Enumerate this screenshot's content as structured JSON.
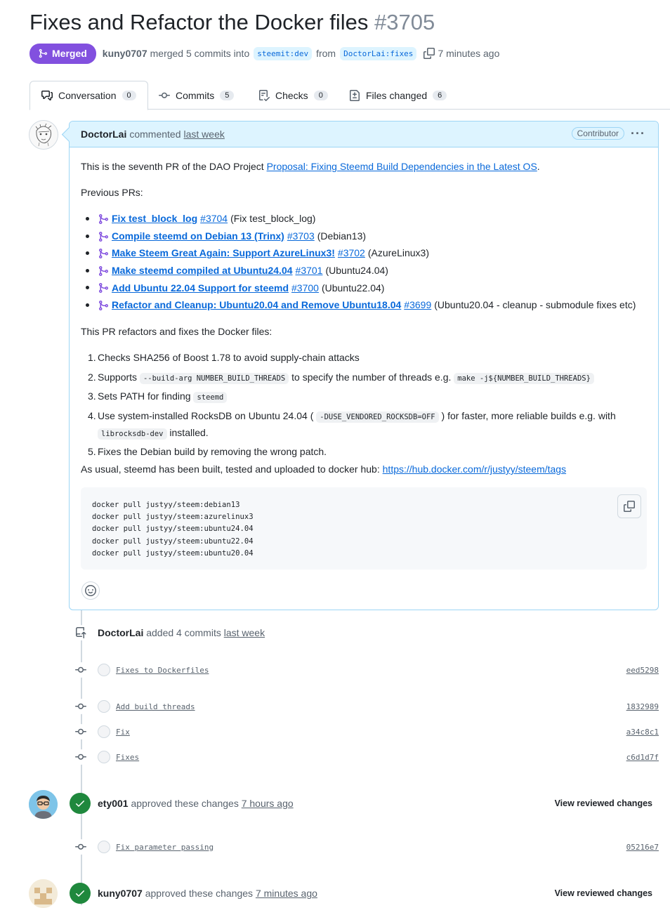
{
  "pr": {
    "title": "Fixes and Refactor the Docker files",
    "number": "#3705",
    "state": "Merged",
    "author": "kuny0707",
    "merged_text": "merged 5 commits into",
    "base_branch": "steemit:dev",
    "from_text": "from",
    "head_branch": "DoctorLai:fixes",
    "time": "7 minutes ago",
    "colors": {
      "merged": "#8250df",
      "link": "#0969da",
      "approved": "#1f883d"
    }
  },
  "tabs": [
    {
      "label": "Conversation",
      "count": "0"
    },
    {
      "label": "Commits",
      "count": "5"
    },
    {
      "label": "Checks",
      "count": "0"
    },
    {
      "label": "Files changed",
      "count": "6"
    }
  ],
  "comment": {
    "author": "DoctorLai",
    "action": "commented",
    "time": "last week",
    "role": "Contributor",
    "intro_text": "This is the seventh PR of the DAO Project",
    "intro_link": "Proposal: Fixing Steemd Build Dependencies in the Latest OS",
    "intro_end": ".",
    "prev_heading": "Previous PRs:",
    "prev_prs": [
      {
        "title": "Fix test_block_log",
        "num": "#3704",
        "note": "(Fix test_block_log)"
      },
      {
        "title": "Compile steemd on Debian 13 (Trinx)",
        "num": "#3703",
        "note": "(Debian13)"
      },
      {
        "title": "Make Steem Great Again: Support AzureLinux3!",
        "num": "#3702",
        "note": "(AzureLinux3)"
      },
      {
        "title": "Make steemd compiled at Ubuntu24.04",
        "num": "#3701",
        "note": "(Ubuntu24.04)"
      },
      {
        "title": "Add Ubuntu 22.04 Support for steemd",
        "num": "#3700",
        "note": "(Ubuntu22.04)"
      },
      {
        "title": "Refactor and Cleanup: Ubuntu20.04 and Remove Ubuntu18.04",
        "num": "#3699",
        "note": "(Ubuntu20.04 - cleanup - submodule fixes etc)"
      }
    ],
    "refactor_heading": "This PR refactors and fixes the Docker files:",
    "items": {
      "i1": "Checks SHA256 of Boost 1.78 to avoid supply-chain attacks",
      "i2a": "Supports",
      "i2code": "--build-arg NUMBER_BUILD_THREADS",
      "i2b": "to specify the number of threads e.g.",
      "i2code2": "make -j${NUMBER_BUILD_THREADS}",
      "i3a": "Sets PATH for finding",
      "i3code": "steemd",
      "i4a": "Use system-installed RocksDB on Ubuntu 24.04 (",
      "i4code": "-DUSE_VENDORED_ROCKSDB=OFF",
      "i4b": ") for faster, more reliable builds e.g. with",
      "i4code2": "librocksdb-dev",
      "i4c": "installed.",
      "i5": "Fixes the Debian build by removing the wrong patch."
    },
    "usual_text": "As usual, steemd has been built, tested and uploaded to docker hub:",
    "usual_link": "https://hub.docker.com/r/justyy/steem/tags",
    "code": "docker pull justyy/steem:debian13\ndocker pull justyy/steem:azurelinux3\ndocker pull justyy/steem:ubuntu24.04\ndocker pull justyy/steem:ubuntu22.04\ndocker pull justyy/steem:ubuntu20.04"
  },
  "timeline": {
    "added": {
      "author": "DoctorLai",
      "text": "added 4 commits",
      "time": "last week"
    },
    "commits": [
      {
        "msg": "Fixes to Dockerfiles",
        "sha": "eed5298"
      },
      {
        "msg": "Add build threads",
        "sha": "1832989"
      },
      {
        "msg": "Fix",
        "sha": "a34c8c1"
      },
      {
        "msg": "Fixes",
        "sha": "c6d1d7f"
      }
    ],
    "review1": {
      "author": "ety001",
      "text": "approved these changes",
      "time": "7 hours ago",
      "link": "View reviewed changes"
    },
    "commit5": {
      "msg": "Fix parameter passing",
      "sha": "05216e7"
    },
    "review2": {
      "author": "kuny0707",
      "text": "approved these changes",
      "time": "7 minutes ago",
      "link": "View reviewed changes"
    }
  }
}
